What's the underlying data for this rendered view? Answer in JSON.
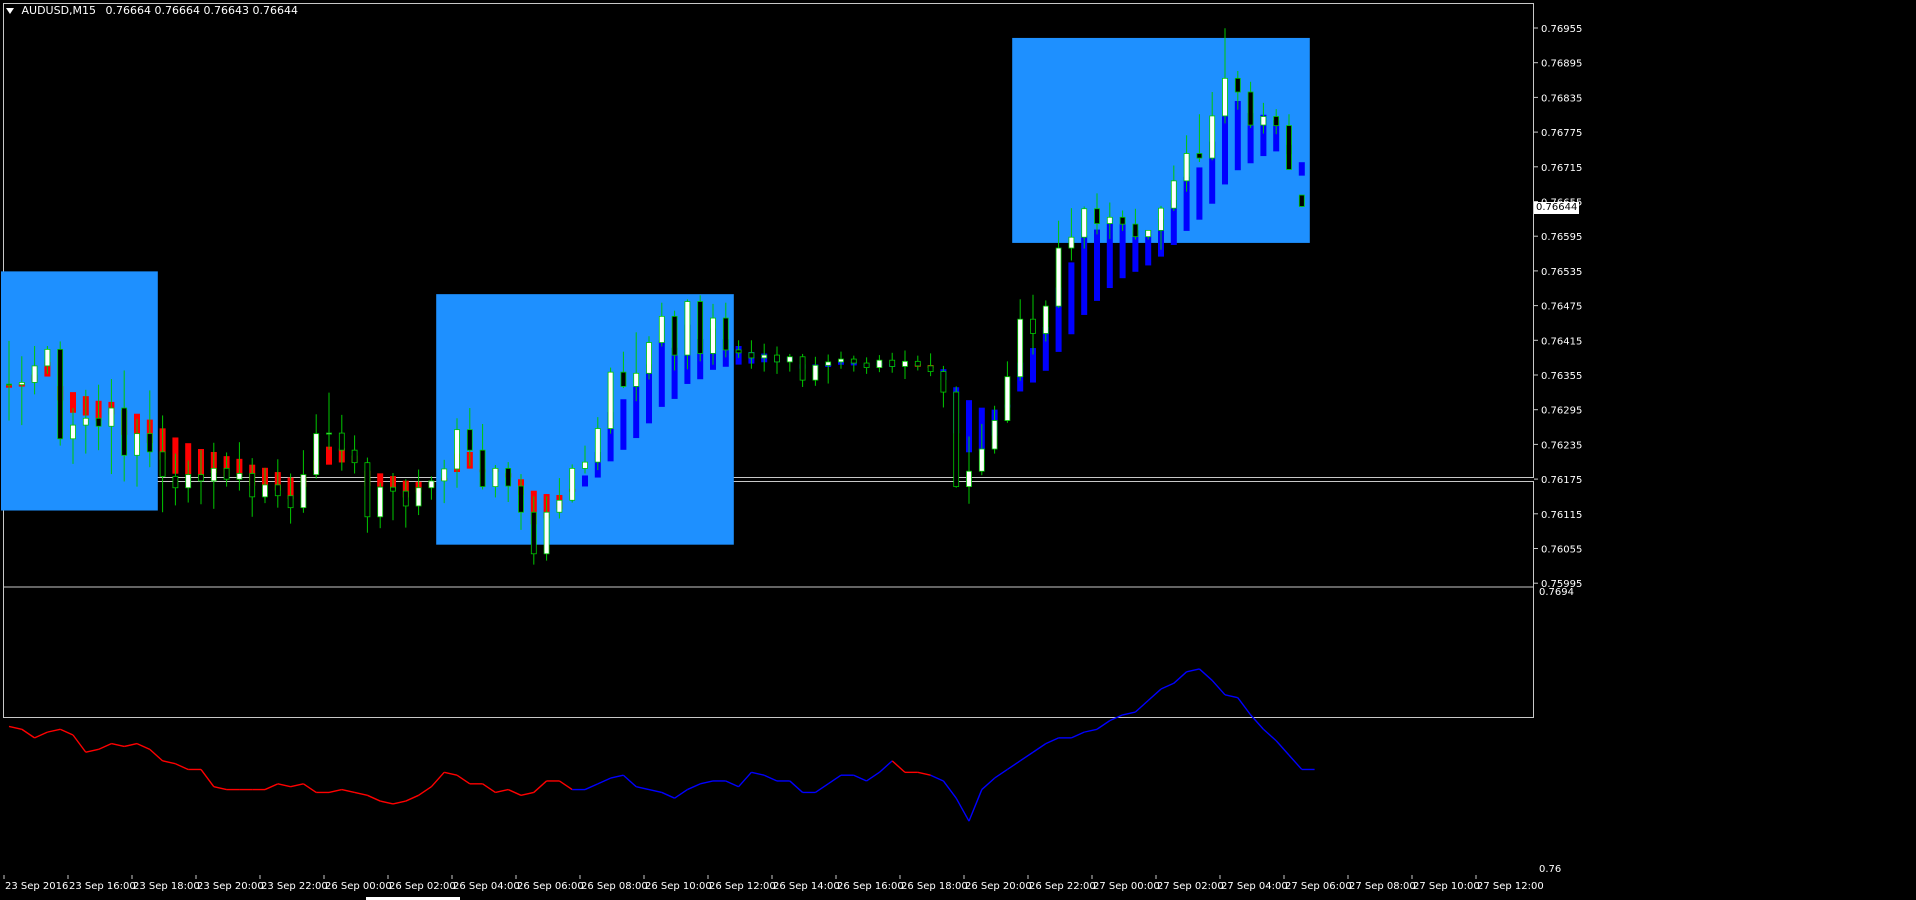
{
  "window": {
    "symbol_title": "AUDUSD,M15",
    "ohlc": "0.76664 0.76664 0.76643 0.76644",
    "current_price_label": "0.76644"
  },
  "colors": {
    "background": "#000000",
    "zone": "#1e90ff",
    "bull_wick": "#00c800",
    "bull_body": "#ffffff",
    "bear_body": "#000000",
    "down_trend": "#ff0000",
    "up_trend": "#0000ff"
  },
  "main_axis": {
    "labels": [
      "0.76955",
      "0.76895",
      "0.76835",
      "0.76775",
      "0.76715",
      "0.76655",
      "0.76595",
      "0.76535",
      "0.76475",
      "0.76415",
      "0.76355",
      "0.76295",
      "0.76235",
      "0.76175",
      "0.76115",
      "0.76055",
      "0.75995"
    ]
  },
  "indicator_axis": {
    "top_label": "0.7694",
    "bottom_label": "0.76"
  },
  "time_axis": {
    "labels": [
      "23 Sep 2016",
      "23 Sep 16:00",
      "23 Sep 18:00",
      "23 Sep 20:00",
      "23 Sep 22:00",
      "26 Sep 00:00",
      "26 Sep 02:00",
      "26 Sep 04:00",
      "26 Sep 06:00",
      "26 Sep 08:00",
      "26 Sep 10:00",
      "26 Sep 12:00",
      "26 Sep 14:00",
      "26 Sep 16:00",
      "26 Sep 18:00",
      "26 Sep 20:00",
      "26 Sep 22:00",
      "27 Sep 00:00",
      "27 Sep 02:00",
      "27 Sep 04:00",
      "27 Sep 06:00",
      "27 Sep 08:00",
      "27 Sep 10:00",
      "27 Sep 12:00"
    ]
  },
  "chart_data": {
    "type": "candlestick",
    "symbol": "AUDUSD",
    "timeframe": "M15",
    "ylim": [
      0.75995,
      0.76975
    ],
    "indicator_ylim": [
      0.76,
      0.7694
    ],
    "zones": [
      {
        "from": 0,
        "to": 11,
        "high": 0.7653,
        "low": 0.7611
      },
      {
        "from": 34,
        "to": 56,
        "high": 0.7649,
        "low": 0.7605
      },
      {
        "from": 79,
        "to": 101,
        "high": 0.7694,
        "low": 0.7658
      }
    ],
    "candles": [
      {
        "o": 0.76332,
        "h": 0.76408,
        "l": 0.76268,
        "c": 0.76331
      },
      {
        "o": 0.76331,
        "h": 0.76381,
        "l": 0.7626,
        "c": 0.76335
      },
      {
        "o": 0.76335,
        "h": 0.76399,
        "l": 0.76314,
        "c": 0.76364
      },
      {
        "o": 0.76364,
        "h": 0.76399,
        "l": 0.7635,
        "c": 0.76393
      },
      {
        "o": 0.76393,
        "h": 0.76407,
        "l": 0.76224,
        "c": 0.76236
      },
      {
        "o": 0.76236,
        "h": 0.7629,
        "l": 0.76192,
        "c": 0.7626
      },
      {
        "o": 0.7626,
        "h": 0.76322,
        "l": 0.7621,
        "c": 0.76272
      },
      {
        "o": 0.76272,
        "h": 0.76331,
        "l": 0.76216,
        "c": 0.76258
      },
      {
        "o": 0.76258,
        "h": 0.76341,
        "l": 0.76174,
        "c": 0.7629
      },
      {
        "o": 0.7629,
        "h": 0.76356,
        "l": 0.76161,
        "c": 0.76207
      },
      {
        "o": 0.76207,
        "h": 0.76271,
        "l": 0.76152,
        "c": 0.76245
      },
      {
        "o": 0.76245,
        "h": 0.76321,
        "l": 0.76186,
        "c": 0.76213
      },
      {
        "o": 0.76213,
        "h": 0.76277,
        "l": 0.76107,
        "c": 0.7617
      },
      {
        "o": 0.7617,
        "h": 0.7621,
        "l": 0.76119,
        "c": 0.7615
      },
      {
        "o": 0.7615,
        "h": 0.76198,
        "l": 0.76124,
        "c": 0.76173
      },
      {
        "o": 0.76173,
        "h": 0.76216,
        "l": 0.76121,
        "c": 0.76162
      },
      {
        "o": 0.76162,
        "h": 0.76229,
        "l": 0.76113,
        "c": 0.76184
      },
      {
        "o": 0.76184,
        "h": 0.76212,
        "l": 0.76152,
        "c": 0.76165
      },
      {
        "o": 0.76165,
        "h": 0.7623,
        "l": 0.76145,
        "c": 0.76175
      },
      {
        "o": 0.76175,
        "h": 0.76202,
        "l": 0.76099,
        "c": 0.76134
      },
      {
        "o": 0.76134,
        "h": 0.76185,
        "l": 0.76123,
        "c": 0.76155
      },
      {
        "o": 0.76155,
        "h": 0.762,
        "l": 0.76115,
        "c": 0.76136
      },
      {
        "o": 0.76136,
        "h": 0.76175,
        "l": 0.76087,
        "c": 0.76115
      },
      {
        "o": 0.76115,
        "h": 0.76216,
        "l": 0.76106,
        "c": 0.76173
      },
      {
        "o": 0.76173,
        "h": 0.76279,
        "l": 0.76166,
        "c": 0.76245
      },
      {
        "o": 0.76245,
        "h": 0.76317,
        "l": 0.76217,
        "c": 0.76246
      },
      {
        "o": 0.76246,
        "h": 0.76278,
        "l": 0.7618,
        "c": 0.76216
      },
      {
        "o": 0.76216,
        "h": 0.76242,
        "l": 0.76175,
        "c": 0.76194
      },
      {
        "o": 0.76194,
        "h": 0.76203,
        "l": 0.76071,
        "c": 0.76099
      },
      {
        "o": 0.76099,
        "h": 0.76159,
        "l": 0.76079,
        "c": 0.76151
      },
      {
        "o": 0.76151,
        "h": 0.76176,
        "l": 0.76093,
        "c": 0.76144
      },
      {
        "o": 0.76144,
        "h": 0.76165,
        "l": 0.7608,
        "c": 0.76118
      },
      {
        "o": 0.76118,
        "h": 0.76182,
        "l": 0.76102,
        "c": 0.7615
      },
      {
        "o": 0.7615,
        "h": 0.7617,
        "l": 0.76129,
        "c": 0.76162
      },
      {
        "o": 0.76162,
        "h": 0.76199,
        "l": 0.76123,
        "c": 0.76183
      },
      {
        "o": 0.76183,
        "h": 0.76272,
        "l": 0.7615,
        "c": 0.76252
      },
      {
        "o": 0.76252,
        "h": 0.7629,
        "l": 0.76188,
        "c": 0.76216
      },
      {
        "o": 0.76216,
        "h": 0.76262,
        "l": 0.76147,
        "c": 0.76152
      },
      {
        "o": 0.76152,
        "h": 0.7619,
        "l": 0.76133,
        "c": 0.76184
      },
      {
        "o": 0.76184,
        "h": 0.76195,
        "l": 0.76125,
        "c": 0.76153
      },
      {
        "o": 0.76153,
        "h": 0.76174,
        "l": 0.76076,
        "c": 0.76107
      },
      {
        "o": 0.76107,
        "h": 0.76135,
        "l": 0.76015,
        "c": 0.76034
      },
      {
        "o": 0.76034,
        "h": 0.76135,
        "l": 0.76022,
        "c": 0.76107
      },
      {
        "o": 0.76107,
        "h": 0.76167,
        "l": 0.76096,
        "c": 0.76128
      },
      {
        "o": 0.76128,
        "h": 0.76191,
        "l": 0.76124,
        "c": 0.76184
      },
      {
        "o": 0.76184,
        "h": 0.76224,
        "l": 0.76175,
        "c": 0.76195
      },
      {
        "o": 0.76195,
        "h": 0.76274,
        "l": 0.76181,
        "c": 0.76254
      },
      {
        "o": 0.76254,
        "h": 0.76361,
        "l": 0.76245,
        "c": 0.76353
      },
      {
        "o": 0.76353,
        "h": 0.76389,
        "l": 0.76325,
        "c": 0.76328
      },
      {
        "o": 0.76328,
        "h": 0.76423,
        "l": 0.76302,
        "c": 0.76351
      },
      {
        "o": 0.76351,
        "h": 0.76416,
        "l": 0.7634,
        "c": 0.76405
      },
      {
        "o": 0.76405,
        "h": 0.76475,
        "l": 0.76398,
        "c": 0.76451
      },
      {
        "o": 0.76451,
        "h": 0.76461,
        "l": 0.76356,
        "c": 0.76383
      },
      {
        "o": 0.76383,
        "h": 0.76481,
        "l": 0.76358,
        "c": 0.76477
      },
      {
        "o": 0.76477,
        "h": 0.76488,
        "l": 0.76372,
        "c": 0.76386
      },
      {
        "o": 0.76386,
        "h": 0.76473,
        "l": 0.76366,
        "c": 0.76448
      },
      {
        "o": 0.76448,
        "h": 0.76475,
        "l": 0.76379,
        "c": 0.76392
      },
      {
        "o": 0.76392,
        "h": 0.76409,
        "l": 0.76378,
        "c": 0.76387
      },
      {
        "o": 0.76387,
        "h": 0.76409,
        "l": 0.76359,
        "c": 0.76378
      },
      {
        "o": 0.76378,
        "h": 0.76403,
        "l": 0.76354,
        "c": 0.76383
      },
      {
        "o": 0.76383,
        "h": 0.76398,
        "l": 0.7635,
        "c": 0.76371
      },
      {
        "o": 0.76371,
        "h": 0.76385,
        "l": 0.76354,
        "c": 0.7638
      },
      {
        "o": 0.7638,
        "h": 0.76385,
        "l": 0.76327,
        "c": 0.76339
      },
      {
        "o": 0.76339,
        "h": 0.7638,
        "l": 0.76329,
        "c": 0.76365
      },
      {
        "o": 0.76365,
        "h": 0.76384,
        "l": 0.76333,
        "c": 0.76371
      },
      {
        "o": 0.76371,
        "h": 0.76389,
        "l": 0.76359,
        "c": 0.76376
      },
      {
        "o": 0.76376,
        "h": 0.76382,
        "l": 0.76354,
        "c": 0.76369
      },
      {
        "o": 0.76369,
        "h": 0.76379,
        "l": 0.7635,
        "c": 0.76361
      },
      {
        "o": 0.76361,
        "h": 0.76383,
        "l": 0.76353,
        "c": 0.76374
      },
      {
        "o": 0.76374,
        "h": 0.76387,
        "l": 0.76352,
        "c": 0.76363
      },
      {
        "o": 0.76363,
        "h": 0.76391,
        "l": 0.76341,
        "c": 0.76372
      },
      {
        "o": 0.76372,
        "h": 0.76382,
        "l": 0.76356,
        "c": 0.76364
      },
      {
        "o": 0.76364,
        "h": 0.76386,
        "l": 0.76346,
        "c": 0.76354
      },
      {
        "o": 0.76354,
        "h": 0.76364,
        "l": 0.76291,
        "c": 0.76318
      },
      {
        "o": 0.76318,
        "h": 0.76328,
        "l": 0.7615,
        "c": 0.76152
      },
      {
        "o": 0.76152,
        "h": 0.7624,
        "l": 0.76122,
        "c": 0.76179
      },
      {
        "o": 0.76179,
        "h": 0.76262,
        "l": 0.76172,
        "c": 0.76218
      },
      {
        "o": 0.76218,
        "h": 0.76294,
        "l": 0.7621,
        "c": 0.76268
      },
      {
        "o": 0.76268,
        "h": 0.76372,
        "l": 0.76264,
        "c": 0.76345
      },
      {
        "o": 0.76345,
        "h": 0.76481,
        "l": 0.76338,
        "c": 0.76446
      },
      {
        "o": 0.76446,
        "h": 0.76489,
        "l": 0.76384,
        "c": 0.76421
      },
      {
        "o": 0.76421,
        "h": 0.76479,
        "l": 0.76407,
        "c": 0.76469
      },
      {
        "o": 0.76469,
        "h": 0.76619,
        "l": 0.76466,
        "c": 0.76571
      },
      {
        "o": 0.76571,
        "h": 0.76641,
        "l": 0.76549,
        "c": 0.7659
      },
      {
        "o": 0.7659,
        "h": 0.76644,
        "l": 0.7657,
        "c": 0.7664
      },
      {
        "o": 0.7664,
        "h": 0.76667,
        "l": 0.76595,
        "c": 0.76614
      },
      {
        "o": 0.76614,
        "h": 0.76651,
        "l": 0.76587,
        "c": 0.76625
      },
      {
        "o": 0.76625,
        "h": 0.76637,
        "l": 0.76601,
        "c": 0.76613
      },
      {
        "o": 0.76613,
        "h": 0.7664,
        "l": 0.76586,
        "c": 0.76591
      },
      {
        "o": 0.76591,
        "h": 0.76602,
        "l": 0.76586,
        "c": 0.76602
      },
      {
        "o": 0.76602,
        "h": 0.76645,
        "l": 0.76568,
        "c": 0.76641
      },
      {
        "o": 0.76641,
        "h": 0.76716,
        "l": 0.76636,
        "c": 0.76689
      },
      {
        "o": 0.76689,
        "h": 0.76769,
        "l": 0.7667,
        "c": 0.76737
      },
      {
        "o": 0.76737,
        "h": 0.76806,
        "l": 0.76722,
        "c": 0.76729
      },
      {
        "o": 0.76729,
        "h": 0.76845,
        "l": 0.76725,
        "c": 0.76803
      },
      {
        "o": 0.76803,
        "h": 0.76957,
        "l": 0.7679,
        "c": 0.76869
      },
      {
        "o": 0.76869,
        "h": 0.76882,
        "l": 0.76814,
        "c": 0.76845
      },
      {
        "o": 0.76845,
        "h": 0.76863,
        "l": 0.76782,
        "c": 0.76787
      },
      {
        "o": 0.76787,
        "h": 0.76826,
        "l": 0.76772,
        "c": 0.76802
      },
      {
        "o": 0.76802,
        "h": 0.76815,
        "l": 0.76771,
        "c": 0.76786
      },
      {
        "o": 0.76786,
        "h": 0.76806,
        "l": 0.76709,
        "c": 0.76709
      },
      {
        "o": 0.76664,
        "h": 0.76664,
        "l": 0.76643,
        "c": 0.76644
      }
    ],
    "indicator": [
      0.765,
      0.7649,
      0.7646,
      0.7648,
      0.7649,
      0.7647,
      0.7641,
      0.7642,
      0.7644,
      0.7643,
      0.7644,
      0.7642,
      0.7638,
      0.7637,
      0.7635,
      0.7635,
      0.7629,
      0.7628,
      0.7628,
      0.7628,
      0.7628,
      0.763,
      0.7629,
      0.763,
      0.7627,
      0.7627,
      0.7628,
      0.7627,
      0.7626,
      0.7624,
      0.7623,
      0.7624,
      0.7626,
      0.7629,
      0.7634,
      0.7633,
      0.763,
      0.763,
      0.7627,
      0.7628,
      0.7626,
      0.7627,
      0.7631,
      0.7631,
      0.7628,
      0.7628,
      0.763,
      0.7632,
      0.7633,
      0.7629,
      0.7628,
      0.7627,
      0.7625,
      0.7628,
      0.763,
      0.7631,
      0.7631,
      0.7629,
      0.7634,
      0.7633,
      0.7631,
      0.7631,
      0.7627,
      0.7627,
      0.763,
      0.7633,
      0.7633,
      0.7631,
      0.7634,
      0.7638,
      0.7634,
      0.7634,
      0.7633,
      0.7631,
      0.7625,
      0.7617,
      0.7628,
      0.7632,
      0.7635,
      0.7638,
      0.7641,
      0.7644,
      0.7646,
      0.7646,
      0.7648,
      0.7649,
      0.7652,
      0.7654,
      0.7655,
      0.7659,
      0.7663,
      0.7665,
      0.7669,
      0.767,
      0.7666,
      0.7661,
      0.766,
      0.7654,
      0.7649,
      0.7645,
      0.764,
      0.7635,
      0.7635
    ],
    "indicator_trend": [
      "down",
      "down",
      "down",
      "down",
      "down",
      "down",
      "down",
      "down",
      "down",
      "down",
      "down",
      "down",
      "down",
      "down",
      "down",
      "down",
      "down",
      "down",
      "down",
      "down",
      "down",
      "down",
      "down",
      "down",
      "down",
      "down",
      "down",
      "down",
      "down",
      "down",
      "down",
      "down",
      "down",
      "down",
      "down",
      "down",
      "down",
      "down",
      "down",
      "down",
      "down",
      "down",
      "down",
      "down",
      "down",
      "up",
      "up",
      "up",
      "up",
      "up",
      "up",
      "up",
      "up",
      "up",
      "up",
      "up",
      "up",
      "up",
      "up",
      "up",
      "up",
      "up",
      "up",
      "up",
      "up",
      "up",
      "up",
      "up",
      "up",
      "up",
      "down",
      "down",
      "down",
      "up",
      "up",
      "up",
      "up",
      "up",
      "up",
      "up",
      "up",
      "up",
      "up",
      "up",
      "up",
      "up",
      "up",
      "up",
      "up",
      "up",
      "up",
      "up",
      "up",
      "up",
      "up",
      "up",
      "up",
      "up",
      "up",
      "up",
      "up",
      "up",
      "up"
    ]
  }
}
